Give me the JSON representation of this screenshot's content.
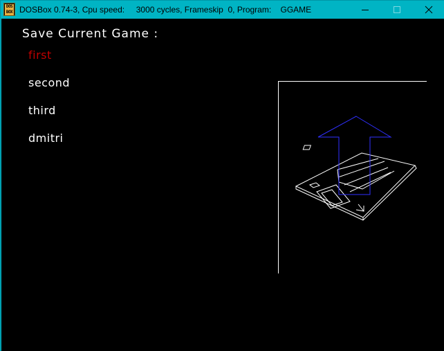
{
  "window": {
    "title": "DOSBox 0.74-3, Cpu speed:     3000 cycles, Frameskip  0, Program:    GGAME",
    "icon_text": [
      "DOS",
      "BOX"
    ],
    "controls": [
      "minimize-icon",
      "maximize-icon",
      "close-icon"
    ]
  },
  "game": {
    "heading": "Save Current Game :",
    "slots": [
      {
        "label": "first",
        "selected": true
      },
      {
        "label": "second",
        "selected": false
      },
      {
        "label": "third",
        "selected": false
      },
      {
        "label": "dmitri",
        "selected": false
      }
    ],
    "colors": {
      "background": "#000000",
      "text": "#ffffff",
      "selected": "#c00000",
      "arrow": "#3030ff",
      "disk": "#ffffff"
    },
    "illustration": "floppy-disk-save-icon"
  }
}
